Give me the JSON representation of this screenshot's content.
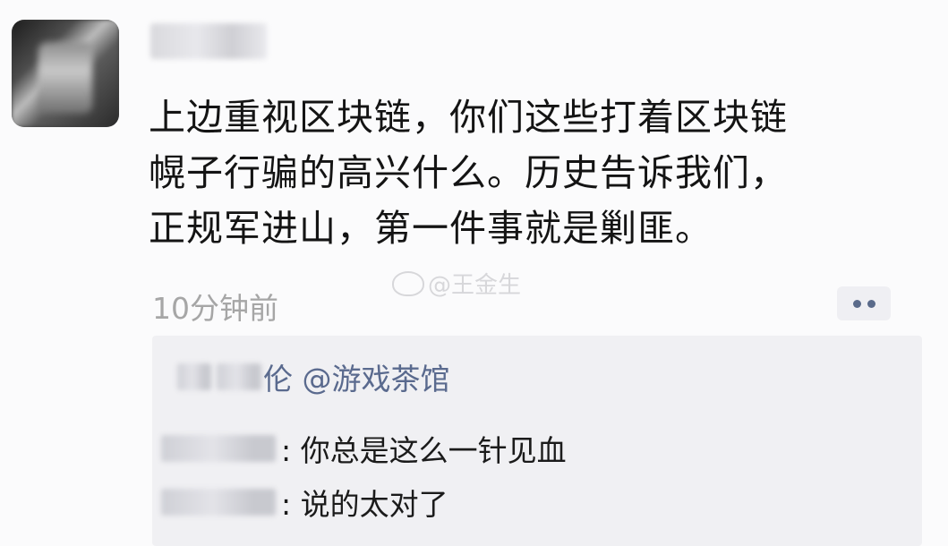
{
  "post": {
    "author_name": "",
    "content_lines": [
      "上边重视区块链，你们这些打着区块链",
      "幌子行骗的高兴什么。历史告诉我们，",
      "正规军进山，第一件事就是剿匪。"
    ],
    "timestamp": "10分钟前",
    "watermark": "@王金生",
    "more_icon": "more-dots-icon"
  },
  "likes": {
    "text": "伦 @游戏茶馆"
  },
  "comments": [
    {
      "author": "",
      "text": ": 你总是这么一针见血"
    },
    {
      "author": "",
      "text": ": 说的太对了"
    }
  ],
  "colors": {
    "link_blue": "#5a6a8e",
    "timestamp_gray": "#a6a6a6",
    "comment_bg": "#f0f0f3"
  }
}
